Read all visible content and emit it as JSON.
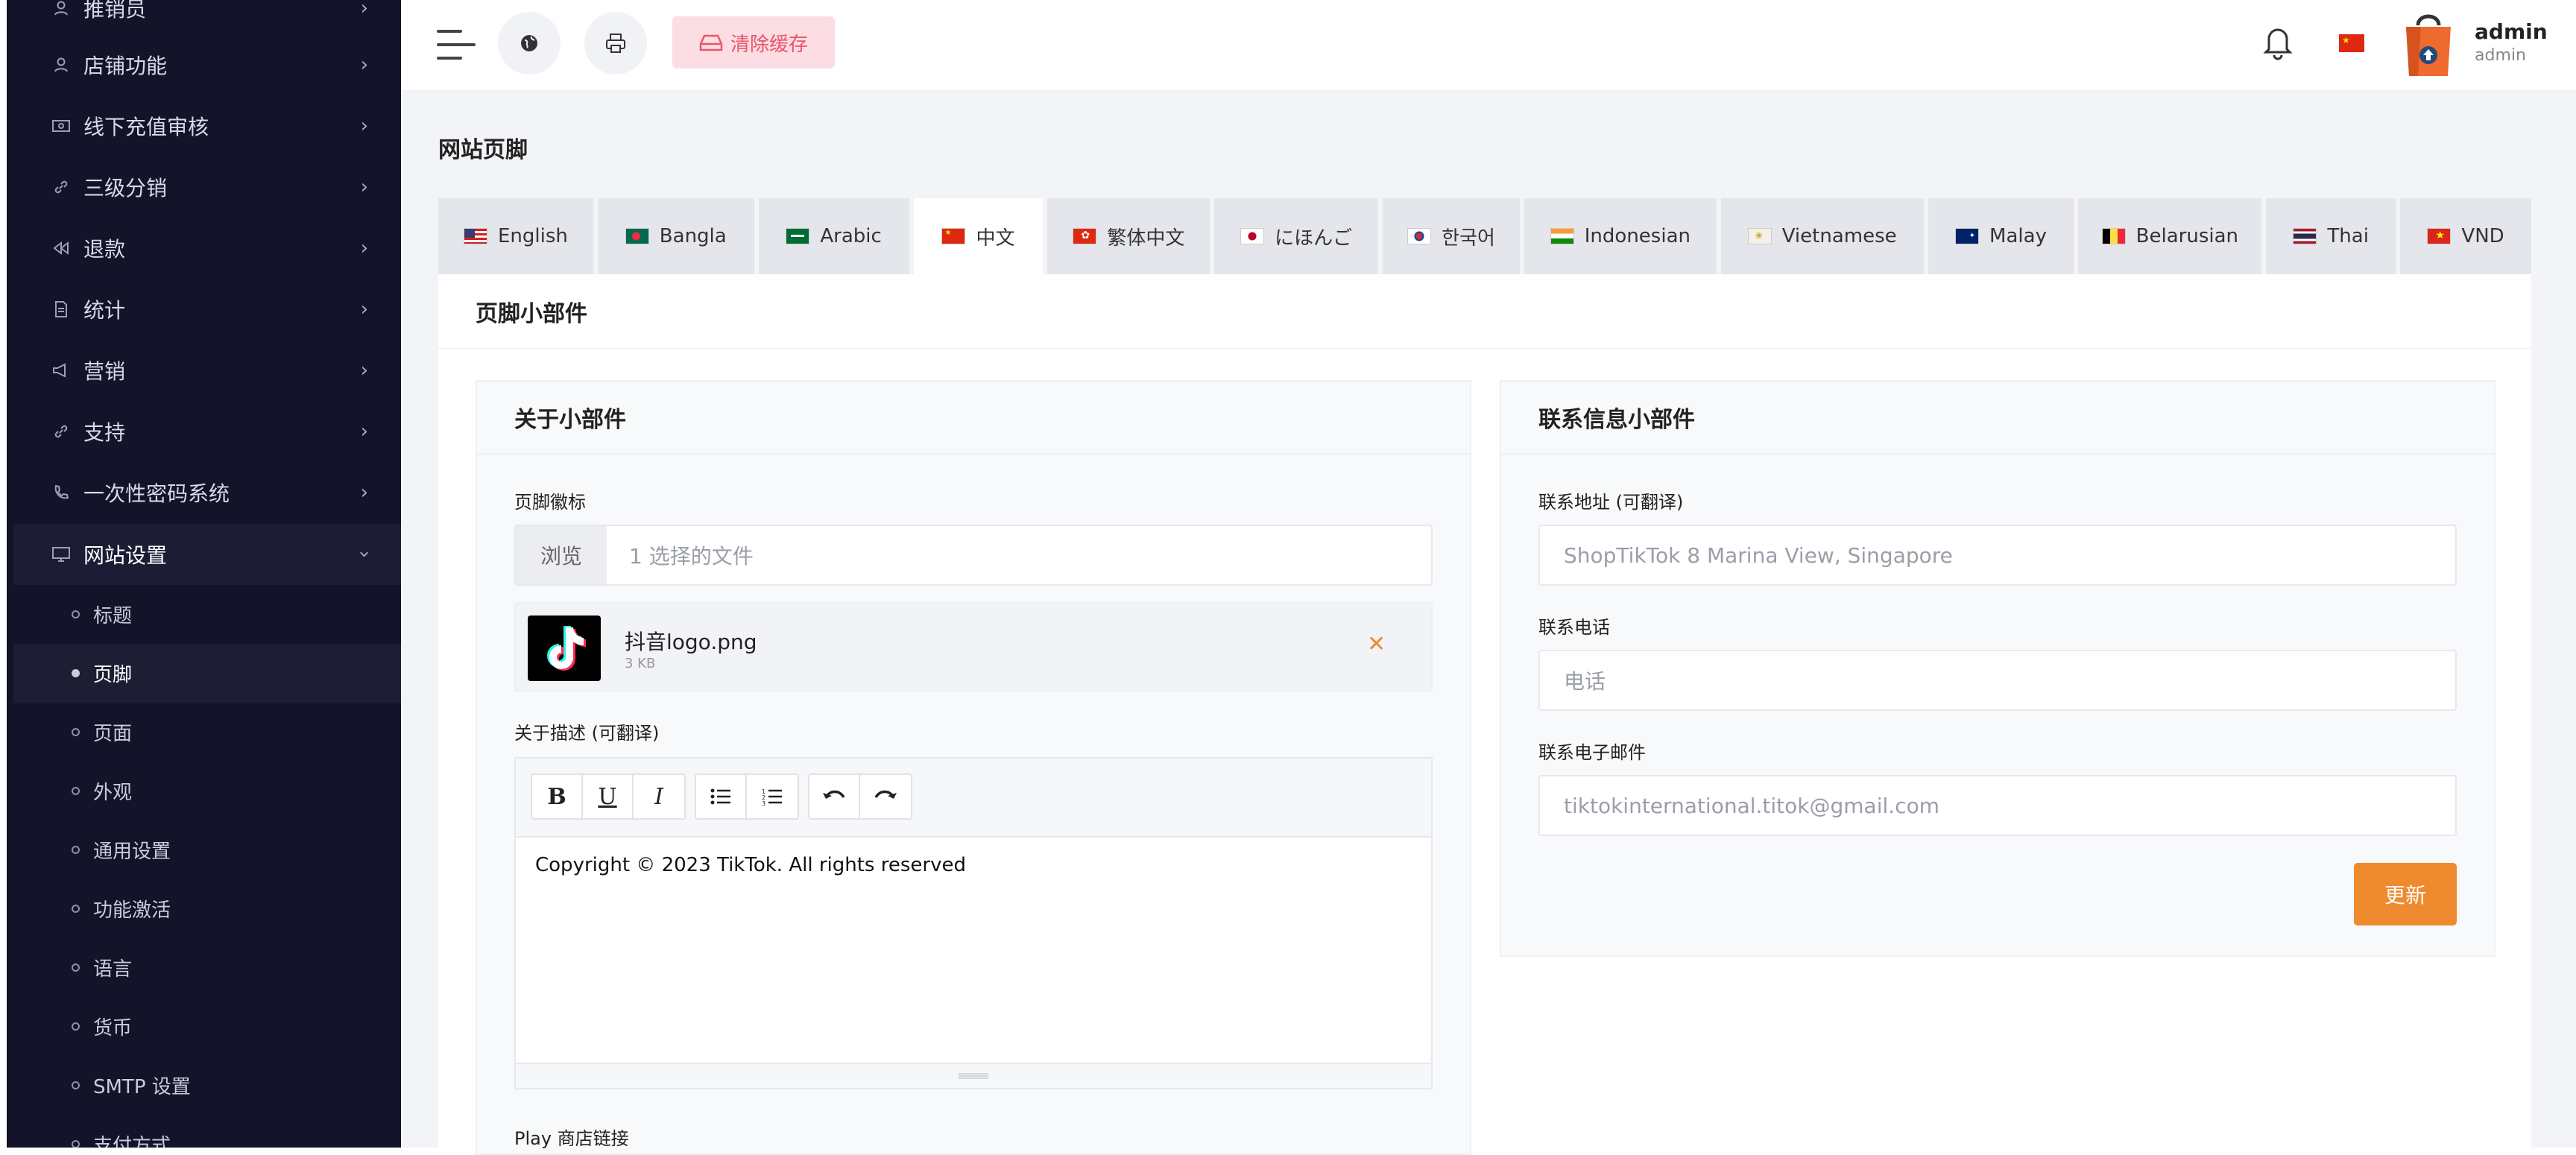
{
  "sidebar": {
    "items": [
      {
        "label": "推销员",
        "icon": "user-icon"
      },
      {
        "label": "店铺功能",
        "icon": "user-icon"
      },
      {
        "label": "线下充值审核",
        "icon": "money-icon"
      },
      {
        "label": "三级分销",
        "icon": "link-icon"
      },
      {
        "label": "退款",
        "icon": "backward-icon"
      },
      {
        "label": "统计",
        "icon": "document-icon"
      },
      {
        "label": "营销",
        "icon": "megaphone-icon"
      },
      {
        "label": "支持",
        "icon": "link-icon"
      },
      {
        "label": "一次性密码系统",
        "icon": "phone-icon"
      },
      {
        "label": "网站设置",
        "icon": "monitor-icon"
      }
    ],
    "subitems": [
      "标题",
      "页脚",
      "页面",
      "外观",
      "通用设置",
      "功能激活",
      "语言",
      "货币",
      "SMTP 设置",
      "支付方式"
    ]
  },
  "topbar": {
    "clear_cache": "清除缓存",
    "user_name": "admin",
    "user_role": "admin"
  },
  "page": {
    "title": "网站页脚",
    "card_title": "页脚小部件"
  },
  "tabs": [
    {
      "label": "English"
    },
    {
      "label": "Bangla"
    },
    {
      "label": "Arabic"
    },
    {
      "label": "中文"
    },
    {
      "label": "繁体中文"
    },
    {
      "label": "にほんご"
    },
    {
      "label": "한국어"
    },
    {
      "label": "Indonesian"
    },
    {
      "label": "Vietnamese"
    },
    {
      "label": "Malay"
    },
    {
      "label": "Belarusian"
    },
    {
      "label": "Thai"
    },
    {
      "label": "VND"
    }
  ],
  "about": {
    "title": "关于小部件",
    "logo_label": "页脚徽标",
    "browse": "浏览",
    "file_count": "1 选择的文件",
    "file_name": "抖音logo.png",
    "file_size": "3 KB",
    "desc_label": "关于描述 (可翻译)",
    "desc_text": "Copyright © 2023 TikTok. All rights reserved",
    "play_label": "Play 商店链接"
  },
  "contact": {
    "title": "联系信息小部件",
    "address_label": "联系地址 (可翻译)",
    "address_value": "ShopTikTok 8 Marina View, Singapore",
    "phone_label": "联系电话",
    "phone_placeholder": "电话",
    "email_label": "联系电子邮件",
    "email_value": "tiktokinternational.titok@gmail.com",
    "update": "更新"
  },
  "colors": {
    "sidebar_bg": "#13132a",
    "accent_orange": "#ef8a2e",
    "cache_pink": "#fcdde3"
  }
}
